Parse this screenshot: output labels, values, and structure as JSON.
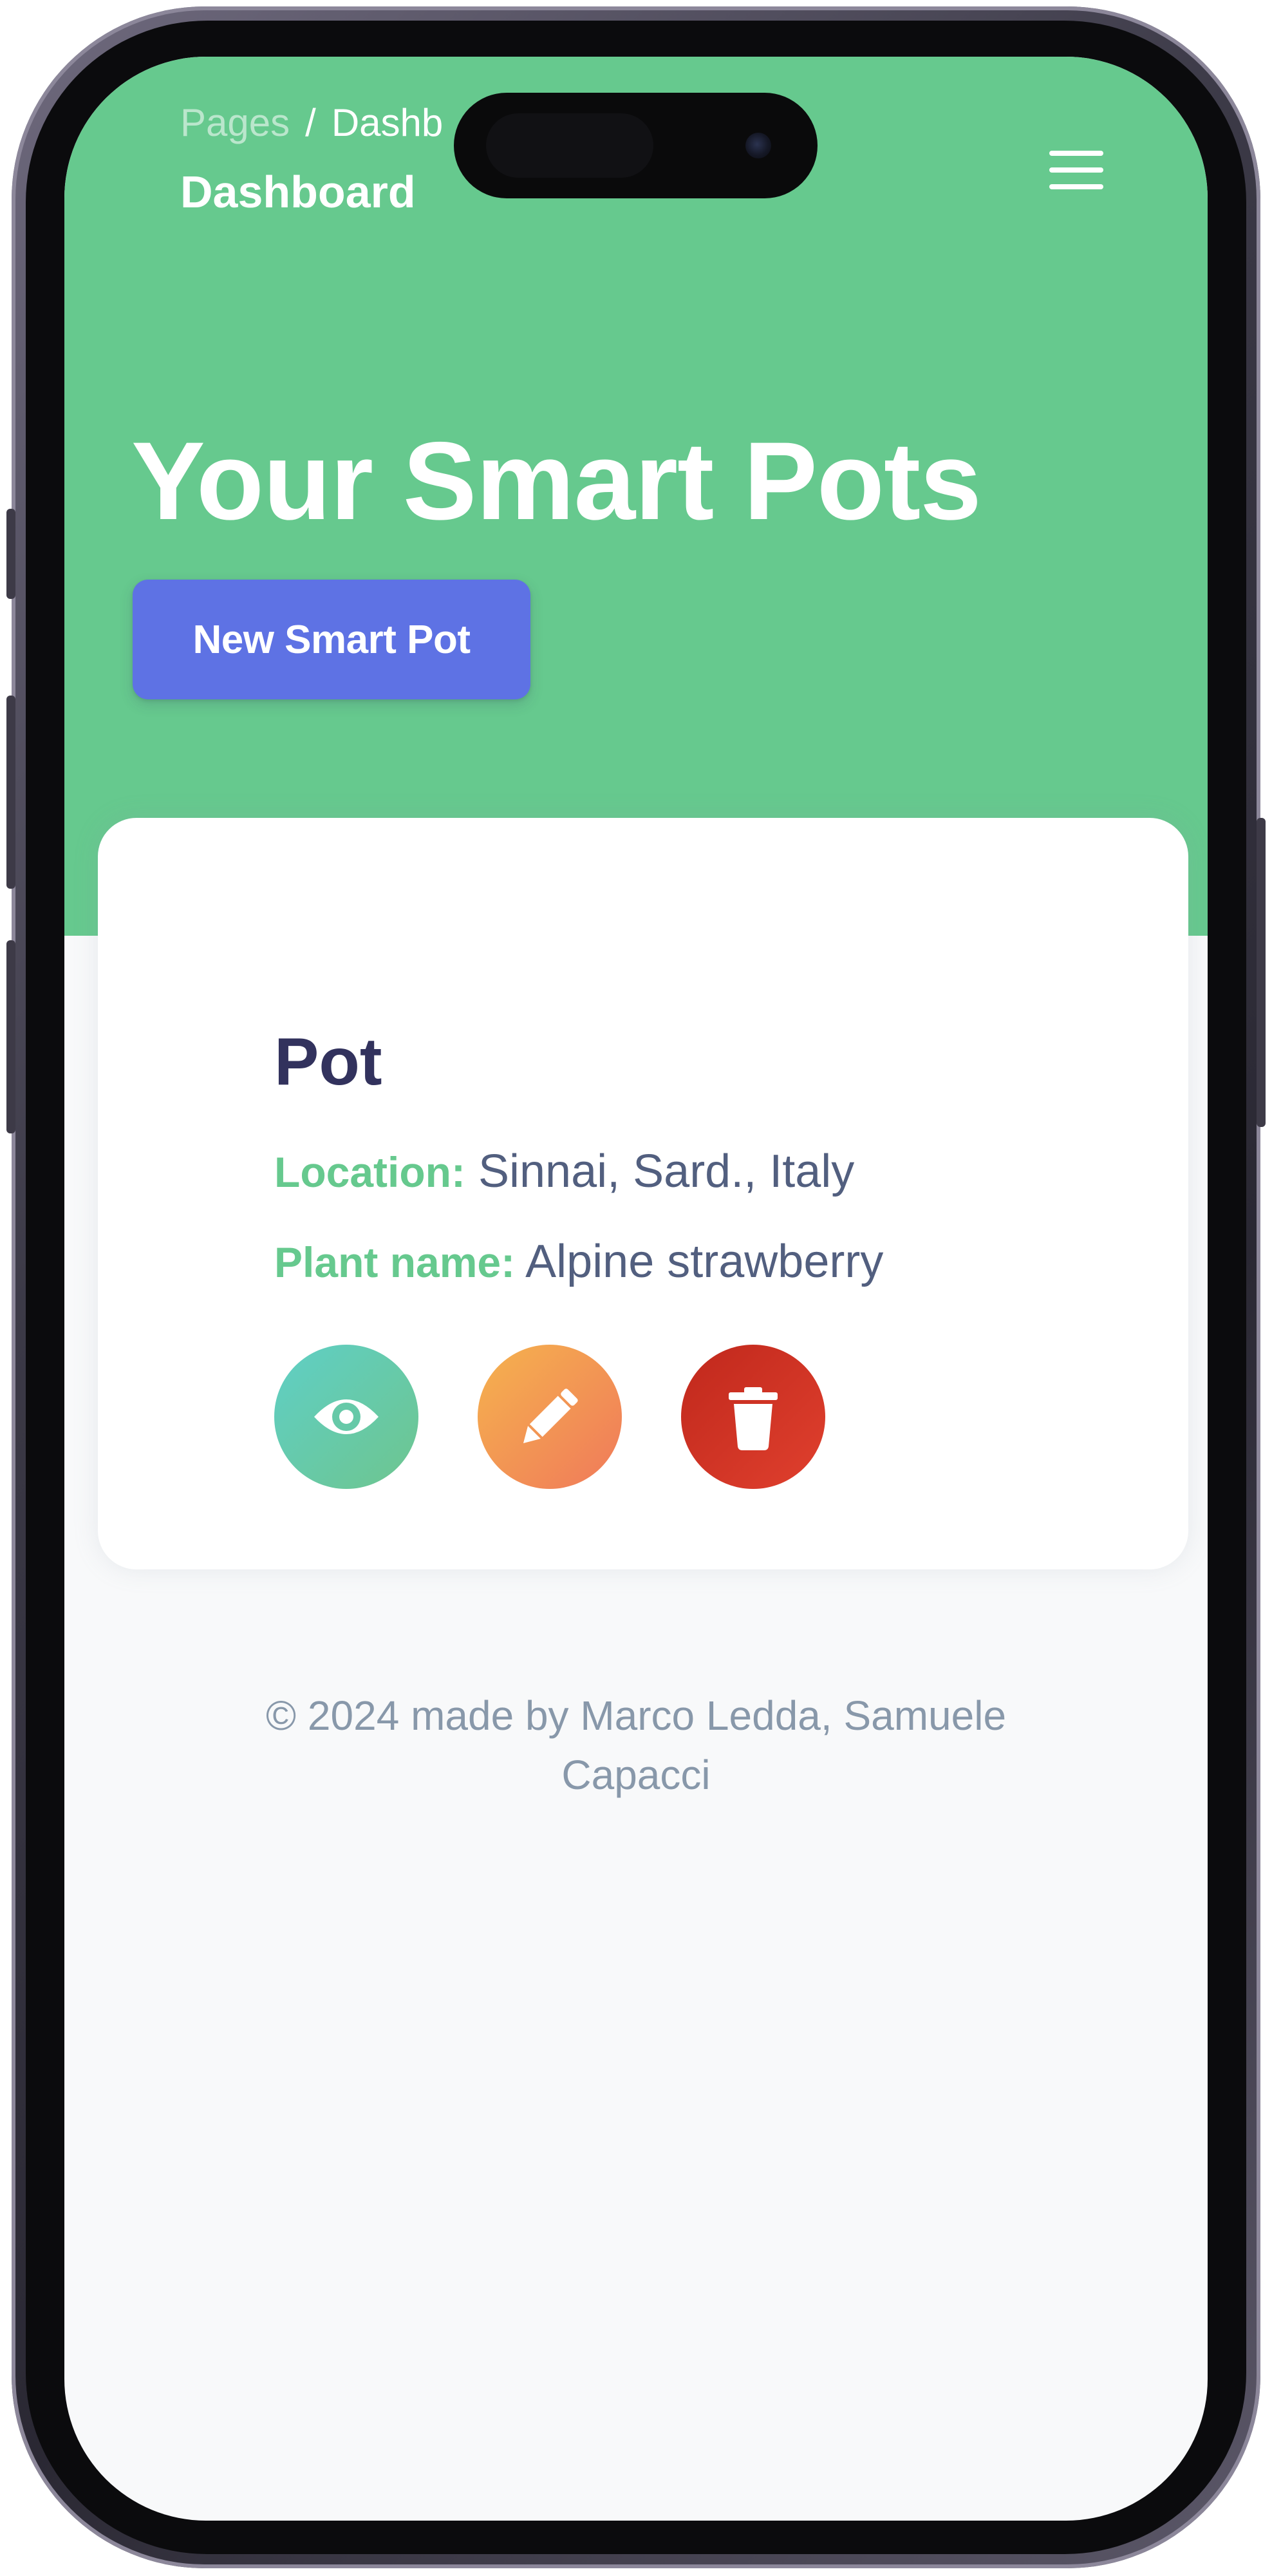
{
  "navbar": {
    "breadcrumb": [
      "Pages",
      "Dashb"
    ],
    "breadcrumb_separator": "/",
    "title": "Dashboard",
    "menu_icon": "hamburger-menu-icon"
  },
  "hero": {
    "heading": "Your Smart Pots",
    "new_pot_label": "New Smart Pot"
  },
  "pot_card": {
    "name": "Pot",
    "location_label": "Location:",
    "location_value": "Sinnai, Sard., Italy",
    "plant_label": "Plant name:",
    "plant_value": "Alpine strawberry",
    "actions": [
      {
        "icon": "eye-icon"
      },
      {
        "icon": "pencil-icon"
      },
      {
        "icon": "trash-icon"
      }
    ]
  },
  "footer": {
    "text": "© 2024 made by Marco Ledda, Samuele Capacci"
  },
  "colors": {
    "hero_green": "#66c98e",
    "primary_button": "#5e72e4",
    "view_button": "#5fcfc6",
    "edit_button": "#f0795a",
    "delete_button": "#c0281c",
    "heading_text": "#32325d",
    "label_green": "#66c98e",
    "body_text": "#525f7f",
    "footer_text": "#8898aa"
  }
}
